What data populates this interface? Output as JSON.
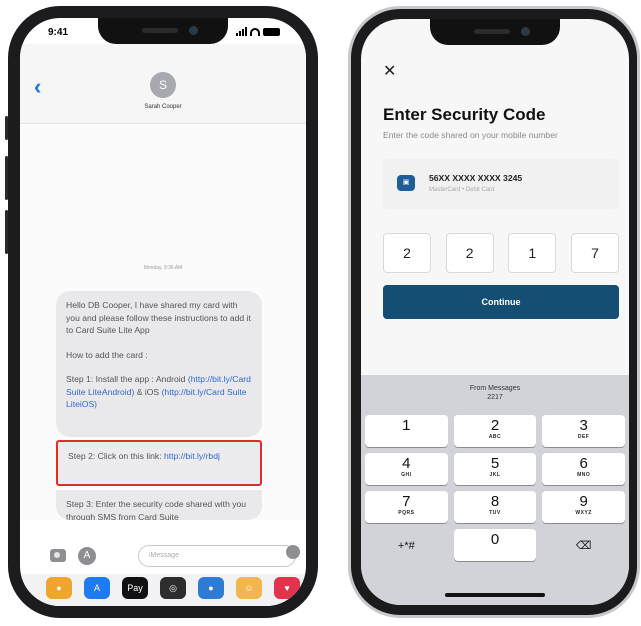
{
  "left_phone": {
    "status": {
      "time": "9:41"
    },
    "header": {
      "back_icon": "chevron-left-icon",
      "avatar_initial": "S",
      "contact_name": "Sarah Cooper"
    },
    "timestamp": "Monday, 9:36 AM",
    "message": {
      "greeting": "Hello DB Cooper, I have shared my card with you and please follow these instructions to add it to Card Suite Lite App",
      "how_to": "How to add the card :",
      "step1_prefix": "Step 1: Install the app : Android ",
      "step1_android_link": "(http://bit.ly/Card Suite LiteAndroid)",
      "step1_mid": " & iOS ",
      "step1_ios_link": "(http://bit.ly/Card Suite LiteiOS)",
      "step2_prefix": "Step 2: Click on this link: ",
      "step2_link": "http://bit.ly/rbdj",
      "step3": "Step 3: Enter the security code shared with you through SMS from Card Suite"
    },
    "composer": {
      "placeholder": "iMessage"
    },
    "app_drawer": [
      "photos",
      "app-store",
      "apple-pay",
      "fitness",
      "memoji",
      "animoji",
      "digital-touch"
    ]
  },
  "right_phone": {
    "close_icon": "close-icon",
    "title": "Enter Security Code",
    "subtitle": "Enter the code shared on your mobile number",
    "card": {
      "number": "56XX XXXX XXXX 3245",
      "type": "MasterCard • Debit Card"
    },
    "code_digits": [
      "2",
      "2",
      "1",
      "7"
    ],
    "continue_label": "Continue",
    "keyboard": {
      "suggestion_label": "From Messages",
      "suggestion_code": "2217",
      "keys": [
        {
          "num": "1",
          "letters": ""
        },
        {
          "num": "2",
          "letters": "ABC"
        },
        {
          "num": "3",
          "letters": "DEF"
        },
        {
          "num": "4",
          "letters": "GHI"
        },
        {
          "num": "5",
          "letters": "JKL"
        },
        {
          "num": "6",
          "letters": "MNO"
        },
        {
          "num": "7",
          "letters": "PQRS"
        },
        {
          "num": "8",
          "letters": "TUV"
        },
        {
          "num": "9",
          "letters": "WXYZ"
        },
        {
          "num": "+*#",
          "letters": ""
        },
        {
          "num": "0",
          "letters": ""
        },
        {
          "num": "⌫",
          "letters": ""
        }
      ]
    }
  },
  "colors": {
    "continue_bg": "#144e73",
    "link": "#2f67d8",
    "highlight_border": "#d9302c"
  }
}
